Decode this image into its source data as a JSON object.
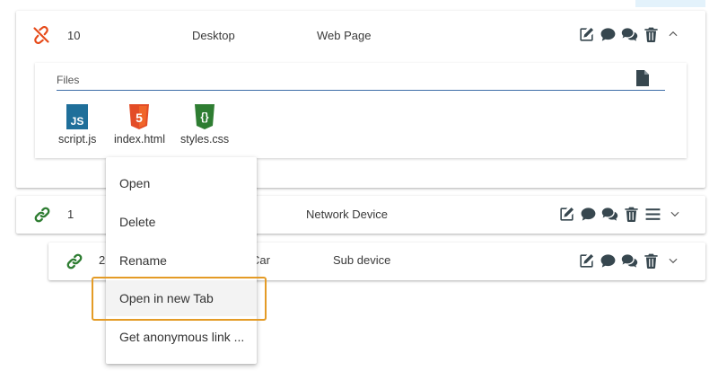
{
  "rows": [
    {
      "id": "10",
      "type": "Desktop",
      "category": "Web Page",
      "status_icon": "broken-link-icon",
      "status_color": "#e64a19",
      "expanded": true
    },
    {
      "id": "1",
      "type": "",
      "category": "Network Device",
      "status_icon": "link-icon",
      "status_color": "#2e7d32",
      "expanded": false
    },
    {
      "id": "2",
      "type": "Car",
      "category": "Sub device",
      "status_icon": "link-icon",
      "status_color": "#2e7d32",
      "expanded": false
    }
  ],
  "files_panel": {
    "label": "Files",
    "files": [
      {
        "name": "script.js",
        "icon": "js-file-icon",
        "color": "#1f6f9a",
        "glyph": "JS"
      },
      {
        "name": "index.html",
        "icon": "html5-file-icon",
        "color": "#e34c26",
        "glyph": "5"
      },
      {
        "name": "styles.css",
        "icon": "css-file-icon",
        "color": "#2e7d32",
        "glyph": "{}"
      }
    ]
  },
  "action_icons": [
    "edit-icon",
    "comment-icon",
    "comments-icon",
    "trash-icon",
    "menu-icon",
    "chevron-icon"
  ],
  "context_menu": {
    "items": [
      "Open",
      "Delete",
      "Rename",
      "Open in new Tab",
      "Get anonymous link ..."
    ],
    "hovered_index": 3
  },
  "colors": {
    "highlight": "#e49b26",
    "icon_dark": "#37474f",
    "files_underline": "#3f6ea8"
  }
}
